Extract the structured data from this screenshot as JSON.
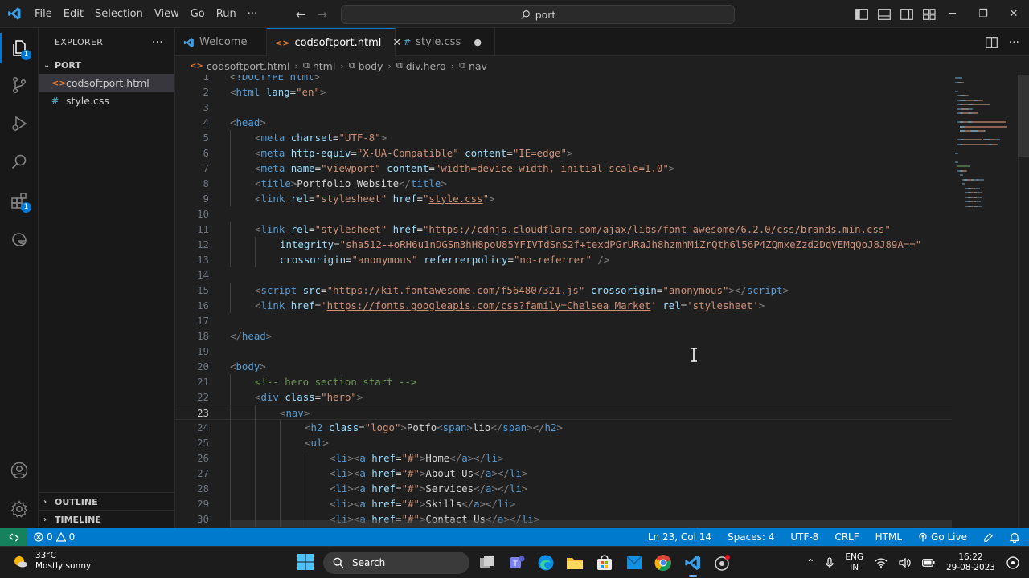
{
  "titlebar": {
    "menu": [
      "File",
      "Edit",
      "Selection",
      "View",
      "Go",
      "Run",
      "···"
    ],
    "search_text": "port",
    "window_controls": [
      "─",
      "❐",
      "✕"
    ]
  },
  "activitybar": {
    "explorer_badge": "1",
    "extensions_badge": "1"
  },
  "sidebar": {
    "title": "EXPLORER",
    "more": "···",
    "folder": "PORT",
    "files": [
      {
        "name": "codsoftport.html",
        "icon": "<>",
        "icon_color": "#e37933"
      },
      {
        "name": "style.css",
        "icon": "#",
        "icon_color": "#519aba"
      }
    ],
    "outline": "OUTLINE",
    "timeline": "TIMELINE"
  },
  "tabs": [
    {
      "label": "Welcome",
      "icon": "vscode-icon"
    },
    {
      "label": "codsoftport.html",
      "icon": "<>",
      "close": "✕"
    },
    {
      "label": "style.css",
      "icon": "#",
      "close": "●"
    }
  ],
  "breadcrumb": [
    "codsoftport.html",
    "html",
    "body",
    "div.hero",
    "nav"
  ],
  "editor": {
    "current_line": 23,
    "lines": [
      {
        "n": 1,
        "indent": 0,
        "tokens": [
          [
            "t",
            "<"
          ],
          [
            "tg",
            "!DOCTYPE html"
          ],
          [
            "t",
            ">"
          ]
        ]
      },
      {
        "n": 2,
        "indent": 0,
        "tokens": [
          [
            "t",
            "<"
          ],
          [
            "tg",
            "html"
          ],
          [
            "x",
            " "
          ],
          [
            "at",
            "lang"
          ],
          [
            "x",
            "="
          ],
          [
            "st",
            "\"en\""
          ],
          [
            "t",
            ">"
          ]
        ]
      },
      {
        "n": 3,
        "indent": 0,
        "tokens": []
      },
      {
        "n": 4,
        "indent": 0,
        "tokens": [
          [
            "t",
            "<"
          ],
          [
            "tg",
            "head"
          ],
          [
            "t",
            ">"
          ]
        ]
      },
      {
        "n": 5,
        "indent": 1,
        "tokens": [
          [
            "t",
            "<"
          ],
          [
            "tg",
            "meta"
          ],
          [
            "x",
            " "
          ],
          [
            "at",
            "charset"
          ],
          [
            "x",
            "="
          ],
          [
            "st",
            "\"UTF-8\""
          ],
          [
            "t",
            ">"
          ]
        ]
      },
      {
        "n": 6,
        "indent": 1,
        "tokens": [
          [
            "t",
            "<"
          ],
          [
            "tg",
            "meta"
          ],
          [
            "x",
            " "
          ],
          [
            "at",
            "http-equiv"
          ],
          [
            "x",
            "="
          ],
          [
            "st",
            "\"X-UA-Compatible\""
          ],
          [
            "x",
            " "
          ],
          [
            "at",
            "content"
          ],
          [
            "x",
            "="
          ],
          [
            "st",
            "\"IE=edge\""
          ],
          [
            "t",
            ">"
          ]
        ]
      },
      {
        "n": 7,
        "indent": 1,
        "tokens": [
          [
            "t",
            "<"
          ],
          [
            "tg",
            "meta"
          ],
          [
            "x",
            " "
          ],
          [
            "at",
            "name"
          ],
          [
            "x",
            "="
          ],
          [
            "st",
            "\"viewport\""
          ],
          [
            "x",
            " "
          ],
          [
            "at",
            "content"
          ],
          [
            "x",
            "="
          ],
          [
            "st",
            "\"width=device-width, initial-scale=1.0\""
          ],
          [
            "t",
            ">"
          ]
        ]
      },
      {
        "n": 8,
        "indent": 1,
        "tokens": [
          [
            "t",
            "<"
          ],
          [
            "tg",
            "title"
          ],
          [
            "t",
            ">"
          ],
          [
            "x",
            "Portfolio Website"
          ],
          [
            "t",
            "</"
          ],
          [
            "tg",
            "title"
          ],
          [
            "t",
            ">"
          ]
        ]
      },
      {
        "n": 9,
        "indent": 1,
        "tokens": [
          [
            "t",
            "<"
          ],
          [
            "tg",
            "link"
          ],
          [
            "x",
            " "
          ],
          [
            "at",
            "rel"
          ],
          [
            "x",
            "="
          ],
          [
            "st",
            "\"stylesheet\""
          ],
          [
            "x",
            " "
          ],
          [
            "at",
            "href"
          ],
          [
            "x",
            "="
          ],
          [
            "st",
            "\""
          ],
          [
            "stu",
            "style.css"
          ],
          [
            "st",
            "\""
          ],
          [
            "t",
            ">"
          ]
        ]
      },
      {
        "n": 10,
        "indent": 0,
        "tokens": []
      },
      {
        "n": 11,
        "indent": 1,
        "tokens": [
          [
            "t",
            "<"
          ],
          [
            "tg",
            "link"
          ],
          [
            "x",
            " "
          ],
          [
            "at",
            "rel"
          ],
          [
            "x",
            "="
          ],
          [
            "st",
            "\"stylesheet\""
          ],
          [
            "x",
            " "
          ],
          [
            "at",
            "href"
          ],
          [
            "x",
            "="
          ],
          [
            "st",
            "\""
          ],
          [
            "stu",
            "https://cdnjs.cloudflare.com/ajax/libs/font-awesome/6.2.0/css/brands.min.css"
          ],
          [
            "st",
            "\""
          ]
        ]
      },
      {
        "n": 12,
        "indent": 2,
        "tokens": [
          [
            "at",
            "integrity"
          ],
          [
            "x",
            "="
          ],
          [
            "st",
            "\"sha512-+oRH6u1nDGSm3hH8poU85YFIVTdSnS2f+texdPGrURaJh8hzmhMiZrQth6l56P4ZQmxeZzd2DqVEMqQoJ8J89A==\""
          ]
        ]
      },
      {
        "n": 13,
        "indent": 2,
        "tokens": [
          [
            "at",
            "crossorigin"
          ],
          [
            "x",
            "="
          ],
          [
            "st",
            "\"anonymous\""
          ],
          [
            "x",
            " "
          ],
          [
            "at",
            "referrerpolicy"
          ],
          [
            "x",
            "="
          ],
          [
            "st",
            "\"no-referrer\""
          ],
          [
            "x",
            " "
          ],
          [
            "t",
            "/>"
          ]
        ]
      },
      {
        "n": 14,
        "indent": 0,
        "tokens": []
      },
      {
        "n": 15,
        "indent": 1,
        "tokens": [
          [
            "t",
            "<"
          ],
          [
            "tg",
            "script"
          ],
          [
            "x",
            " "
          ],
          [
            "at",
            "src"
          ],
          [
            "x",
            "="
          ],
          [
            "st",
            "\""
          ],
          [
            "stu",
            "https://kit.fontawesome.com/f564807321.js"
          ],
          [
            "st",
            "\""
          ],
          [
            "x",
            " "
          ],
          [
            "at",
            "crossorigin"
          ],
          [
            "x",
            "="
          ],
          [
            "st",
            "\"anonymous\""
          ],
          [
            "t",
            "></"
          ],
          [
            "tg",
            "script"
          ],
          [
            "t",
            ">"
          ]
        ]
      },
      {
        "n": 16,
        "indent": 1,
        "tokens": [
          [
            "t",
            "<"
          ],
          [
            "tg",
            "link"
          ],
          [
            "x",
            " "
          ],
          [
            "at",
            "href"
          ],
          [
            "x",
            "="
          ],
          [
            "st",
            "'"
          ],
          [
            "stu",
            "https://fonts.googleapis.com/css?family=Chelsea Market"
          ],
          [
            "st",
            "'"
          ],
          [
            "x",
            " "
          ],
          [
            "at",
            "rel"
          ],
          [
            "x",
            "="
          ],
          [
            "st",
            "'stylesheet'"
          ],
          [
            "t",
            ">"
          ]
        ]
      },
      {
        "n": 17,
        "indent": 0,
        "tokens": []
      },
      {
        "n": 18,
        "indent": 0,
        "tokens": [
          [
            "t",
            "</"
          ],
          [
            "tg",
            "head"
          ],
          [
            "t",
            ">"
          ]
        ]
      },
      {
        "n": 19,
        "indent": 0,
        "tokens": []
      },
      {
        "n": 20,
        "indent": 0,
        "tokens": [
          [
            "t",
            "<"
          ],
          [
            "tg",
            "body"
          ],
          [
            "t",
            ">"
          ]
        ]
      },
      {
        "n": 21,
        "indent": 1,
        "tokens": [
          [
            "cm",
            "<!-- hero section start -->"
          ]
        ]
      },
      {
        "n": 22,
        "indent": 1,
        "tokens": [
          [
            "t",
            "<"
          ],
          [
            "tg",
            "div"
          ],
          [
            "x",
            " "
          ],
          [
            "at",
            "class"
          ],
          [
            "x",
            "="
          ],
          [
            "st",
            "\"hero\""
          ],
          [
            "t",
            ">"
          ]
        ]
      },
      {
        "n": 23,
        "indent": 2,
        "tokens": [
          [
            "t",
            "<"
          ],
          [
            "tg",
            "nav"
          ],
          [
            "t",
            ">"
          ]
        ]
      },
      {
        "n": 24,
        "indent": 3,
        "tokens": [
          [
            "t",
            "<"
          ],
          [
            "tg",
            "h2"
          ],
          [
            "x",
            " "
          ],
          [
            "at",
            "class"
          ],
          [
            "x",
            "="
          ],
          [
            "st",
            "\"logo\""
          ],
          [
            "t",
            ">"
          ],
          [
            "x",
            "Potfo"
          ],
          [
            "t",
            "<"
          ],
          [
            "tg",
            "span"
          ],
          [
            "t",
            ">"
          ],
          [
            "x",
            "lio"
          ],
          [
            "t",
            "</"
          ],
          [
            "tg",
            "span"
          ],
          [
            "t",
            "></"
          ],
          [
            "tg",
            "h2"
          ],
          [
            "t",
            ">"
          ]
        ]
      },
      {
        "n": 25,
        "indent": 3,
        "tokens": [
          [
            "t",
            "<"
          ],
          [
            "tg",
            "ul"
          ],
          [
            "t",
            ">"
          ]
        ]
      },
      {
        "n": 26,
        "indent": 4,
        "tokens": [
          [
            "t",
            "<"
          ],
          [
            "tg",
            "li"
          ],
          [
            "t",
            "><"
          ],
          [
            "tg",
            "a"
          ],
          [
            "x",
            " "
          ],
          [
            "at",
            "href"
          ],
          [
            "x",
            "="
          ],
          [
            "st",
            "\"#\""
          ],
          [
            "t",
            ">"
          ],
          [
            "x",
            "Home"
          ],
          [
            "t",
            "</"
          ],
          [
            "tg",
            "a"
          ],
          [
            "t",
            "></"
          ],
          [
            "tg",
            "li"
          ],
          [
            "t",
            ">"
          ]
        ]
      },
      {
        "n": 27,
        "indent": 4,
        "tokens": [
          [
            "t",
            "<"
          ],
          [
            "tg",
            "li"
          ],
          [
            "t",
            "><"
          ],
          [
            "tg",
            "a"
          ],
          [
            "x",
            " "
          ],
          [
            "at",
            "href"
          ],
          [
            "x",
            "="
          ],
          [
            "st",
            "\"#\""
          ],
          [
            "t",
            ">"
          ],
          [
            "x",
            "About Us"
          ],
          [
            "t",
            "</"
          ],
          [
            "tg",
            "a"
          ],
          [
            "t",
            "></"
          ],
          [
            "tg",
            "li"
          ],
          [
            "t",
            ">"
          ]
        ]
      },
      {
        "n": 28,
        "indent": 4,
        "tokens": [
          [
            "t",
            "<"
          ],
          [
            "tg",
            "li"
          ],
          [
            "t",
            "><"
          ],
          [
            "tg",
            "a"
          ],
          [
            "x",
            " "
          ],
          [
            "at",
            "href"
          ],
          [
            "x",
            "="
          ],
          [
            "st",
            "\"#\""
          ],
          [
            "t",
            ">"
          ],
          [
            "x",
            "Services"
          ],
          [
            "t",
            "</"
          ],
          [
            "tg",
            "a"
          ],
          [
            "t",
            "></"
          ],
          [
            "tg",
            "li"
          ],
          [
            "t",
            ">"
          ]
        ]
      },
      {
        "n": 29,
        "indent": 4,
        "tokens": [
          [
            "t",
            "<"
          ],
          [
            "tg",
            "li"
          ],
          [
            "t",
            "><"
          ],
          [
            "tg",
            "a"
          ],
          [
            "x",
            " "
          ],
          [
            "at",
            "href"
          ],
          [
            "x",
            "="
          ],
          [
            "st",
            "\"#\""
          ],
          [
            "t",
            ">"
          ],
          [
            "x",
            "Skills"
          ],
          [
            "t",
            "</"
          ],
          [
            "tg",
            "a"
          ],
          [
            "t",
            "></"
          ],
          [
            "tg",
            "li"
          ],
          [
            "t",
            ">"
          ]
        ]
      },
      {
        "n": 30,
        "indent": 4,
        "tokens": [
          [
            "t",
            "<"
          ],
          [
            "tg",
            "li"
          ],
          [
            "t",
            "><"
          ],
          [
            "tg",
            "a"
          ],
          [
            "x",
            " "
          ],
          [
            "at",
            "href"
          ],
          [
            "x",
            "="
          ],
          [
            "st",
            "\"#\""
          ],
          [
            "t",
            ">"
          ],
          [
            "x",
            "Contact Us"
          ],
          [
            "t",
            "</"
          ],
          [
            "tg",
            "a"
          ],
          [
            "t",
            "></"
          ],
          [
            "tg",
            "li"
          ],
          [
            "t",
            ">"
          ]
        ]
      }
    ]
  },
  "statusbar": {
    "errors": "0",
    "warnings": "0",
    "position": "Ln 23, Col 14",
    "spaces": "Spaces: 4",
    "encoding": "UTF-8",
    "eol": "CRLF",
    "language": "HTML",
    "golive": "Go Live"
  },
  "taskbar": {
    "temperature": "33°C",
    "weather": "Mostly sunny",
    "search": "Search",
    "lang_top": "ENG",
    "lang_bottom": "IN",
    "time": "16:22",
    "date": "29-08-2023"
  },
  "colors": {
    "accent": "#0078d4",
    "statusbar": "#007acc",
    "remote": "#16825d",
    "tag": "#569cd6",
    "attr": "#9cdcfe",
    "string": "#ce9178",
    "comment": "#6a9955"
  }
}
